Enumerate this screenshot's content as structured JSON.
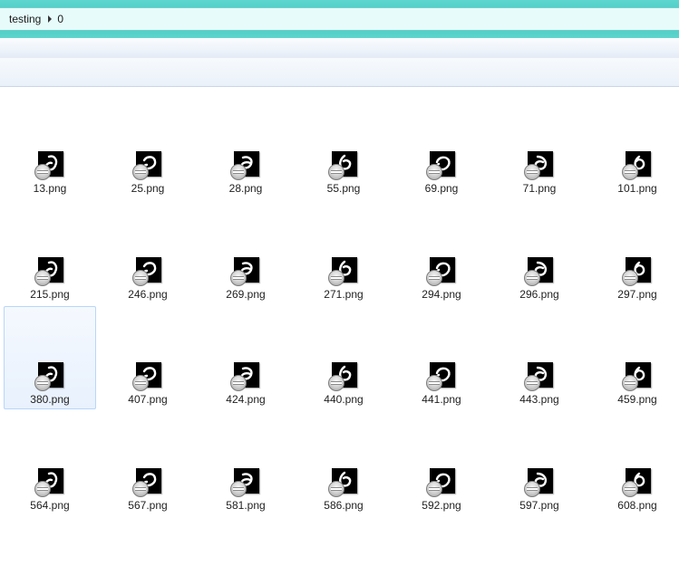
{
  "address": {
    "crumbs": [
      "testing",
      "0"
    ]
  },
  "files": [
    {
      "name": "13.png"
    },
    {
      "name": "25.png"
    },
    {
      "name": "28.png"
    },
    {
      "name": "55.png"
    },
    {
      "name": "69.png"
    },
    {
      "name": "71.png"
    },
    {
      "name": "101.png"
    },
    {
      "name": "215.png"
    },
    {
      "name": "246.png"
    },
    {
      "name": "269.png"
    },
    {
      "name": "271.png"
    },
    {
      "name": "294.png"
    },
    {
      "name": "296.png"
    },
    {
      "name": "297.png"
    },
    {
      "name": "380.png",
      "selected": true
    },
    {
      "name": "407.png"
    },
    {
      "name": "424.png"
    },
    {
      "name": "440.png"
    },
    {
      "name": "441.png"
    },
    {
      "name": "443.png"
    },
    {
      "name": "459.png"
    },
    {
      "name": "564.png"
    },
    {
      "name": "567.png"
    },
    {
      "name": "581.png"
    },
    {
      "name": "586.png"
    },
    {
      "name": "592.png"
    },
    {
      "name": "597.png"
    },
    {
      "name": "608.png"
    }
  ],
  "icons": {
    "thumbnail": "handwritten-digit-thumbnail-icon",
    "overlay": "blocked-overlay-icon",
    "separator": "chevron-right-icon"
  },
  "colors": {
    "address_frame": "#3ec9c1",
    "address_bg": "#e6fbfa",
    "selection_bg": "#e8f1fd",
    "selection_border": "#b8d6fb"
  }
}
